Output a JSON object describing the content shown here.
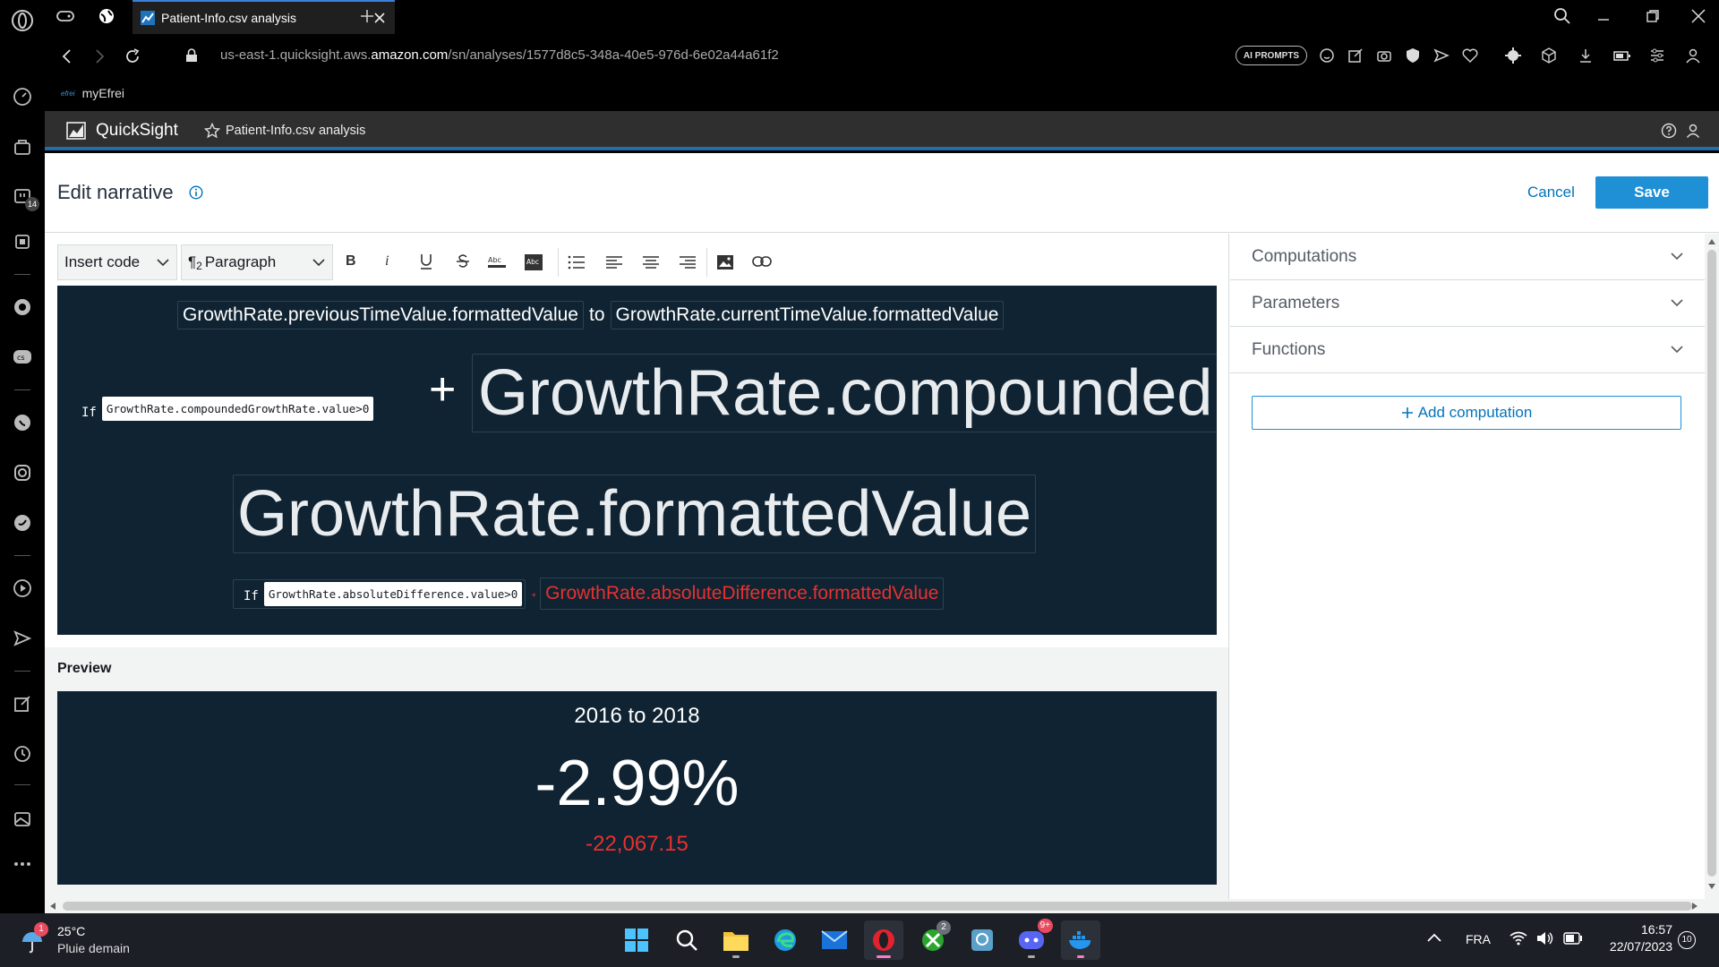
{
  "browser": {
    "tab_title": "Patient-Info.csv analysis",
    "url_prefix": "us-east-1.quicksight.aws.",
    "url_domain": "amazon.com",
    "url_path": "/sn/analyses/1577d8c5-348a-40e5-976d-6e02a44a61f2",
    "ai_prompts_label": "AI PROMPTS",
    "bookmark_icon_text": "efrei",
    "bookmark_label": "myEfrei",
    "sidebar_badge": "14"
  },
  "quicksight": {
    "brand": "QuickSight",
    "analysis_name": "Patient-Info.csv analysis"
  },
  "editor": {
    "title": "Edit narrative",
    "cancel_label": "Cancel",
    "save_label": "Save",
    "toolbar": {
      "insert_code": "Insert code",
      "paragraph_prefix": "¶",
      "paragraph_sub": "2",
      "paragraph_label": "Paragraph"
    },
    "narrative": {
      "prev_value": "GrowthRate.previousTimeValue.formattedValue",
      "to_label": "to",
      "current_value": "GrowthRate.currentTimeValue.formattedValue",
      "if1_keyword": "If",
      "if1_condition": "GrowthRate.compoundedGrowthRate.value>0",
      "plus_sign": "+",
      "compounded": "GrowthRate.compounded",
      "formatted_value": "GrowthRate.formattedValue",
      "if2_keyword": "If",
      "if2_condition": "GrowthRate.absoluteDifference.value>0",
      "plus_sign_small": "+",
      "absolute_difference": "GrowthRate.absoluteDifference.formattedValue"
    },
    "preview": {
      "heading": "Preview",
      "period": "2016 to 2018",
      "growth": "-2.99%",
      "difference": "-22,067.15"
    },
    "panel": {
      "sections": [
        "Computations",
        "Parameters",
        "Functions"
      ],
      "add_computation": "Add computation"
    }
  },
  "taskbar": {
    "weather_temp": "25°C",
    "weather_desc": "Pluie demain",
    "weather_badge": "1",
    "xbox_badge": "2",
    "discord_badge": "9+",
    "language": "FRA",
    "time": "16:57",
    "date": "22/07/2023",
    "notification_count": "10"
  },
  "colors": {
    "narrative_bg": "#0f2332",
    "accent_blue": "#1f8fd6",
    "negative_red": "#e8312f",
    "taskbar_bg": "#1c1f26"
  }
}
